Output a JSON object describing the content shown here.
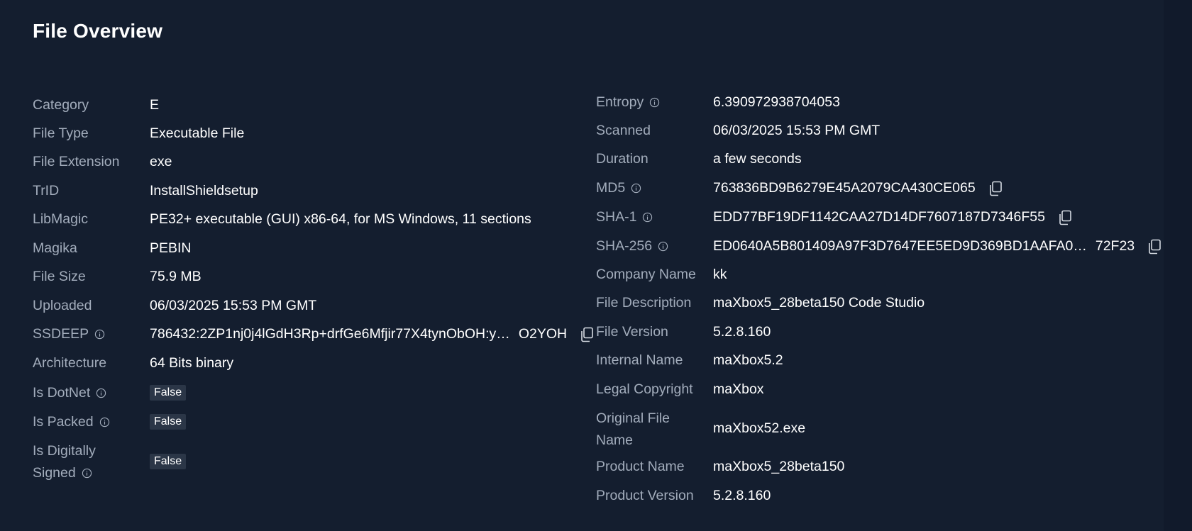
{
  "title": "File Overview",
  "left": [
    {
      "label": "Category",
      "value": "E"
    },
    {
      "label": "File Type",
      "value": "Executable File"
    },
    {
      "label": "File Extension",
      "value": "exe"
    },
    {
      "label": "TrID",
      "value": "InstallShieldsetup"
    },
    {
      "label": "LibMagic",
      "value": "PE32+ executable (GUI) x86-64, for MS Windows, 11 sections"
    },
    {
      "label": "Magika",
      "value": "PEBIN"
    },
    {
      "label": "File Size",
      "value": "75.9 MB"
    },
    {
      "label": "Uploaded",
      "value": "06/03/2025 15:53 PM GMT"
    },
    {
      "label": "SSDEEP",
      "value": "786432:2ZP1nj0j4lGdH3Rp+drfGe6Mfjir77X4tynObOH:y…",
      "value_end": "O2YOH"
    },
    {
      "label": "Architecture",
      "value": "64 Bits binary"
    },
    {
      "label": "Is DotNet",
      "value": "False"
    },
    {
      "label": "Is Packed",
      "value": "False"
    },
    {
      "label_line1": "Is Digitally",
      "label_line2": "Signed",
      "value": "False"
    }
  ],
  "right": [
    {
      "label": "Entropy",
      "value": "6.390972938704053"
    },
    {
      "label": "Scanned",
      "value": "06/03/2025 15:53 PM GMT"
    },
    {
      "label": "Duration",
      "value": "a few seconds"
    },
    {
      "label": "MD5",
      "value": "763836BD9B6279E45A2079CA430CE065"
    },
    {
      "label": "SHA-1",
      "value": "EDD77BF19DF1142CAA27D14DF7607187D7346F55"
    },
    {
      "label": "SHA-256",
      "value": "ED0640A5B801409A97F3D7647EE5ED9D369BD1AAFA0…",
      "value_end": "72F23"
    },
    {
      "label": "Company Name",
      "value": "kk"
    },
    {
      "label": "File Description",
      "value": "maXbox5_28beta150 Code Studio"
    },
    {
      "label": "File Version",
      "value": "5.2.8.160"
    },
    {
      "label": "Internal Name",
      "value": "maXbox5.2"
    },
    {
      "label": "Legal Copyright",
      "value": "maXbox"
    },
    {
      "label_line1": "Original File",
      "label_line2": "Name",
      "value": "maXbox52.exe"
    },
    {
      "label": "Product Name",
      "value": "maXbox5_28beta150"
    },
    {
      "label": "Product Version",
      "value": "5.2.8.160"
    }
  ],
  "icons": {
    "info": "info-circle-icon",
    "copy": "copy-icon"
  },
  "colors": {
    "background": "#141e2f",
    "label": "#a3adbc",
    "value": "#ffffff",
    "badge_bg": "#2b3647"
  }
}
